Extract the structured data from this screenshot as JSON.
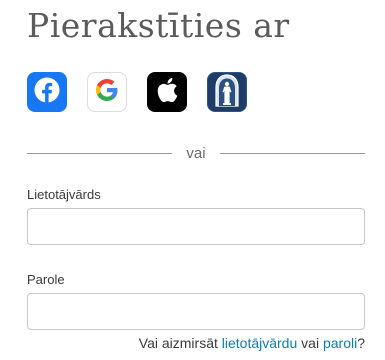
{
  "header": {
    "title": "Pierakstīties ar"
  },
  "social_login": [
    {
      "name": "facebook",
      "icon": "facebook-icon",
      "color": "#1877f2"
    },
    {
      "name": "google",
      "icon": "google-icon",
      "color": "#ffffff"
    },
    {
      "name": "apple",
      "icon": "apple-icon",
      "color": "#000000"
    },
    {
      "name": "church",
      "icon": "church-christus-icon",
      "color": "#1f3b67"
    }
  ],
  "divider": {
    "text": "vai"
  },
  "form": {
    "username_label": "Lietotājvārds",
    "username_value": "",
    "password_label": "Parole",
    "password_value": ""
  },
  "forgot": {
    "prefix": "Vai aizmirsāt ",
    "username_link": "lietotājvārdu",
    "middle": " vai ",
    "password_link": "paroli",
    "suffix": "?"
  },
  "colors": {
    "link": "#0b7fb5",
    "title": "#5b5b5b"
  }
}
